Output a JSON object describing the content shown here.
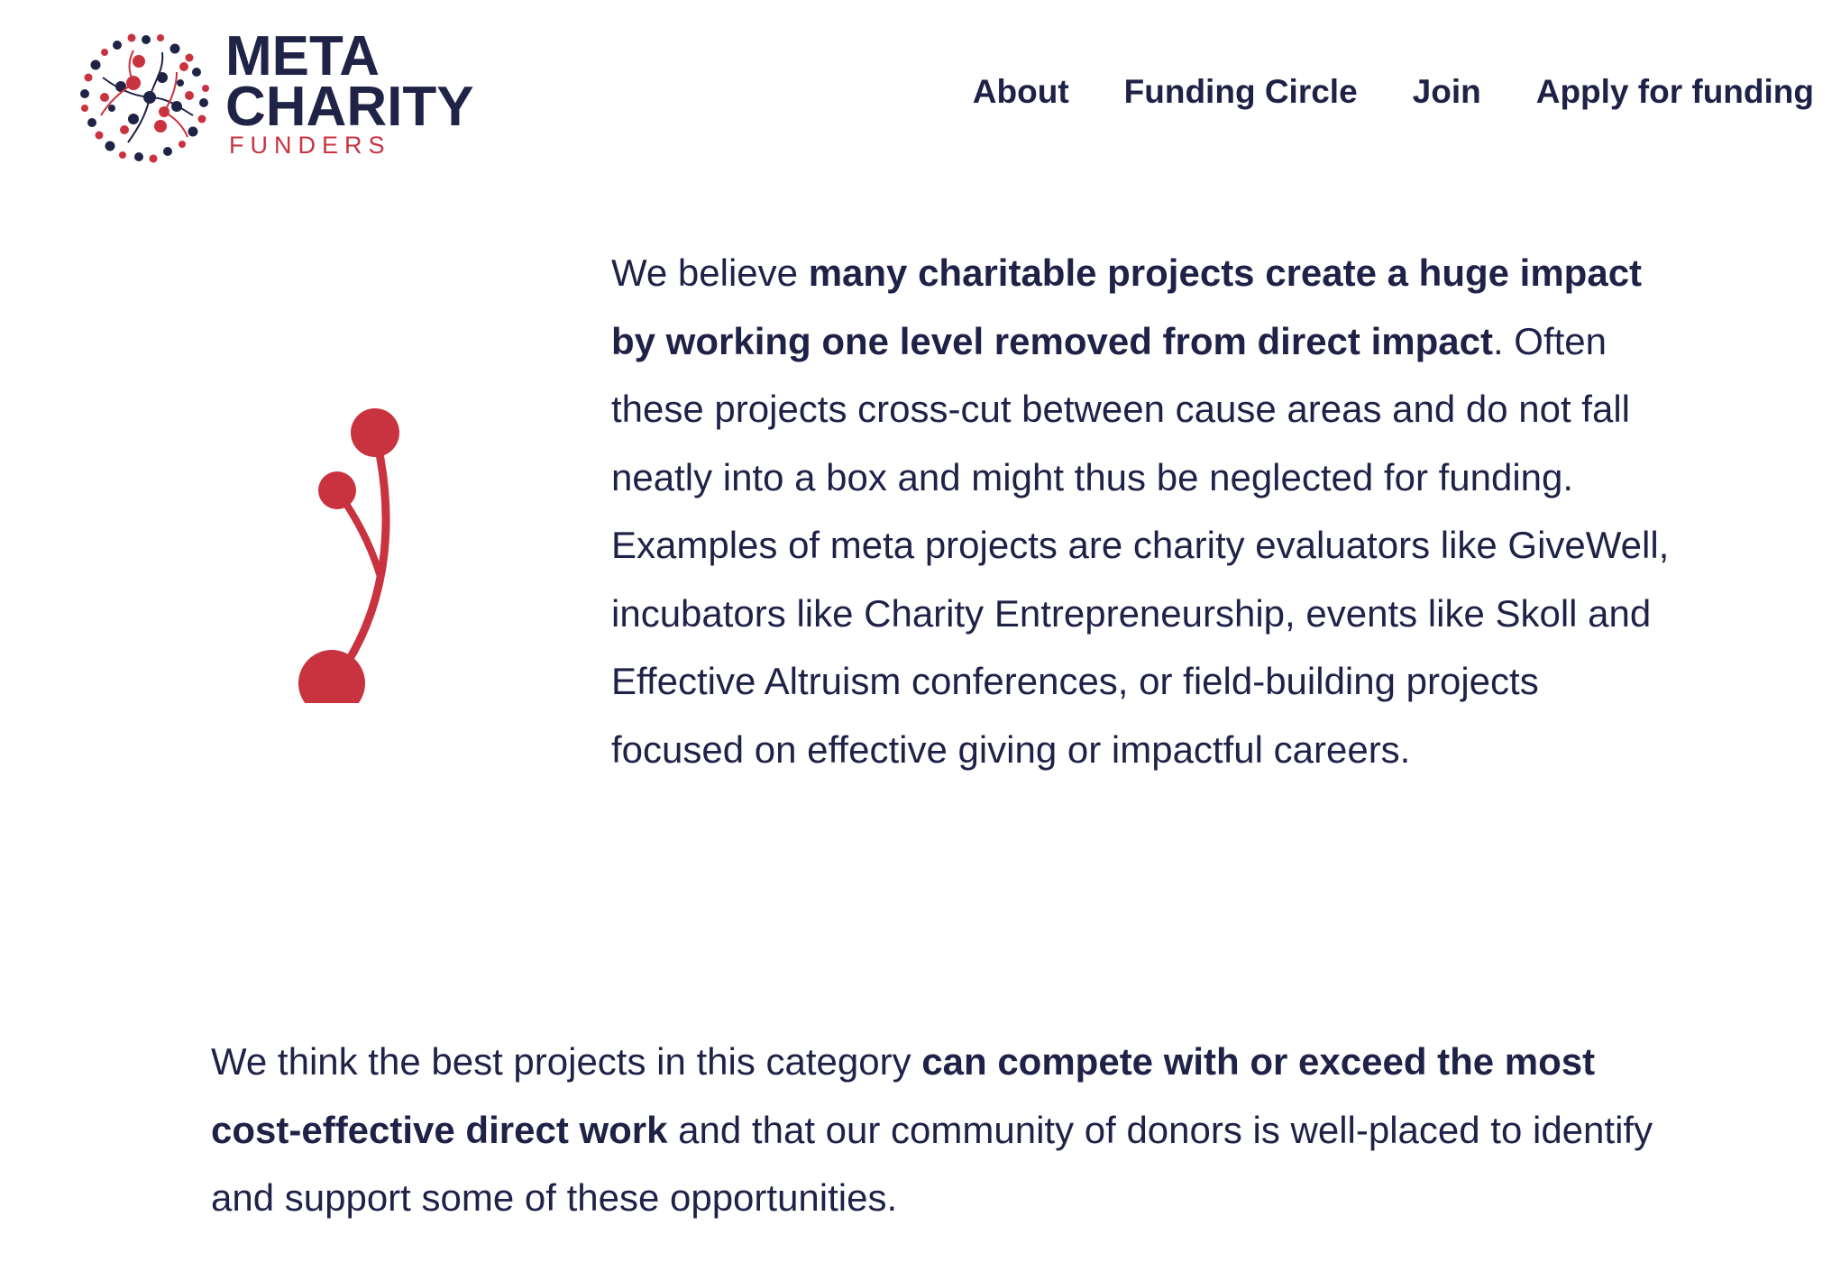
{
  "header": {
    "logo": {
      "line1": "META",
      "line2": "CHARITY",
      "line3": "FUNDERS"
    },
    "nav": [
      {
        "label": "About"
      },
      {
        "label": "Funding Circle"
      },
      {
        "label": "Join"
      },
      {
        "label": "Apply for funding"
      }
    ]
  },
  "section1": {
    "illustration_icon": "branch-dots-icon",
    "paragraph": {
      "lead": "We believe ",
      "emphasis": "many charitable projects create a huge impact by working one level removed from direct impact",
      "rest": ". Often these projects cross-cut between cause areas and do not fall neatly into a box and might thus be neglected for funding. Examples of meta projects are charity evaluators like GiveWell, incubators like Charity Entrepreneurship, events like Skoll and Effective Altruism conferences, or field-building projects focused on effective giving or impactful careers."
    }
  },
  "section2": {
    "paragraph": {
      "lead": "We think the best projects in this category ",
      "emphasis": "can compete with or exceed the most cost-effective direct work",
      "rest": " and that our community of donors is well-placed to identify and support some of these opportunities."
    }
  },
  "colors": {
    "navy": "#1f2247",
    "red": "#c9323f",
    "background": "#ffffff"
  }
}
